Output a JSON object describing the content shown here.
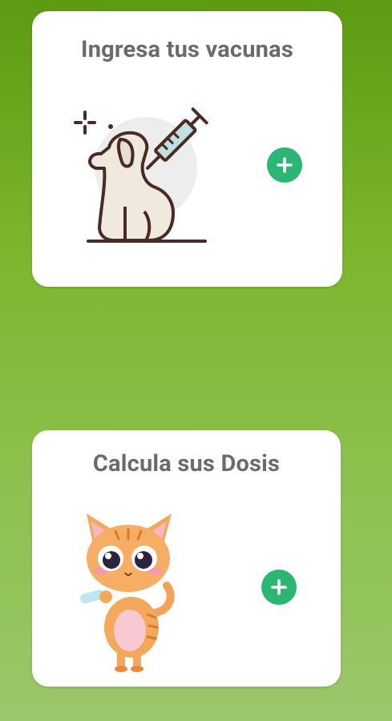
{
  "cards": [
    {
      "title": "Ingresa tus vacunas",
      "illustration": "dog-vaccine-illustration",
      "action_icon": "plus-icon"
    },
    {
      "title": "Calcula sus Dosis",
      "illustration": "cat-syringe-illustration",
      "action_icon": "plus-icon"
    }
  ],
  "colors": {
    "background_top": "#5c9b12",
    "background_bottom": "#9bc76a",
    "card": "#ffffff",
    "title_text": "#6b6b6b",
    "accent_button": "#2bb673"
  }
}
